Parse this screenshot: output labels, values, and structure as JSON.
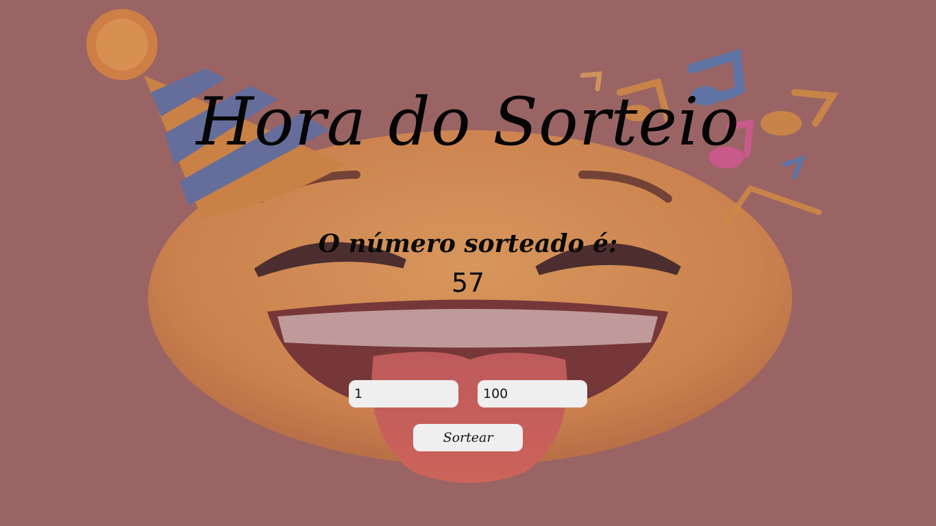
{
  "page": {
    "title": "Hora do Sorteio",
    "background_color": "#9a6565"
  },
  "result": {
    "label": "O número sorteado é:",
    "value": "57"
  },
  "range": {
    "min_value": "1",
    "max_value": "100"
  },
  "actions": {
    "draw_label": "Sortear"
  },
  "background_image": {
    "icon": "party-emoji-face-icon"
  }
}
